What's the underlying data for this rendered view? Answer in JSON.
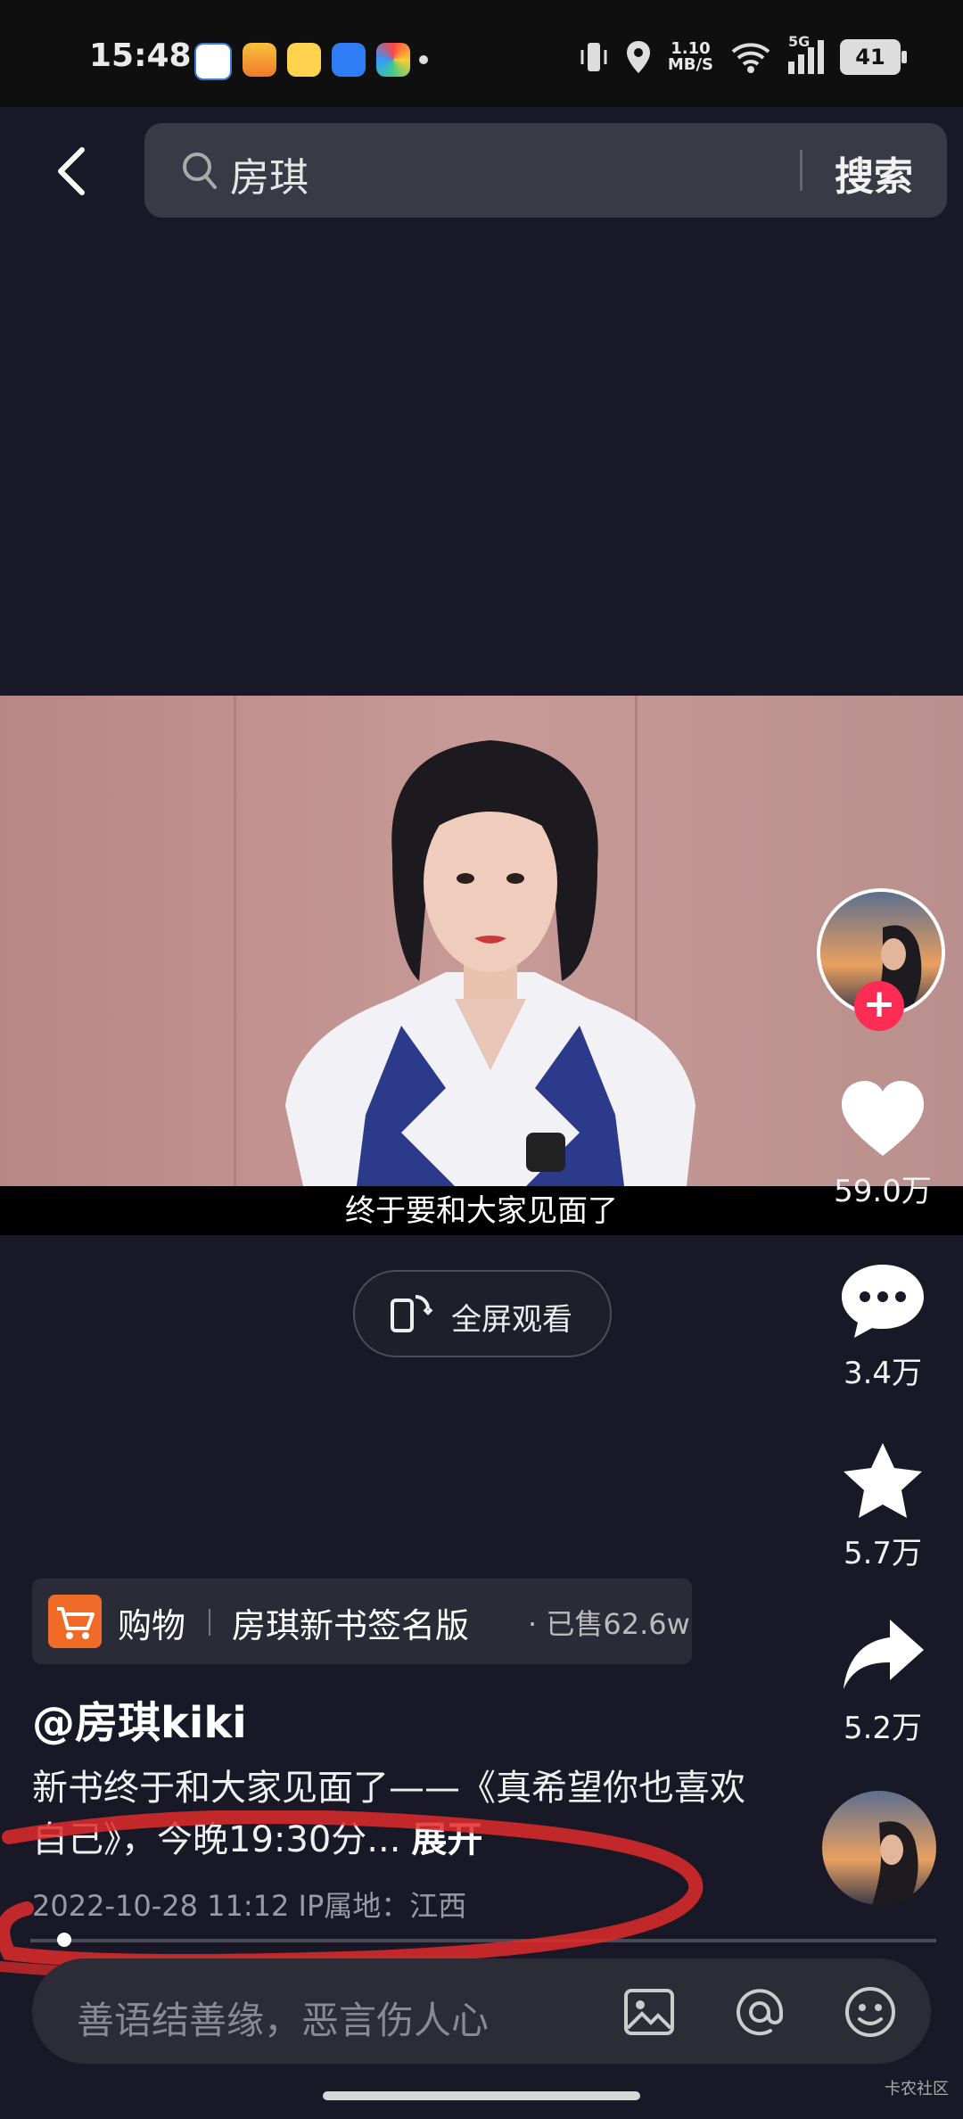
{
  "status_bar": {
    "time": "15:48",
    "net_speed_value": "1.10",
    "net_speed_unit": "MB/S",
    "network": "5G",
    "battery": "41"
  },
  "search": {
    "query": "房琪",
    "button": "搜索"
  },
  "video": {
    "subtitle": "终于要和大家见面了"
  },
  "fullscreen": {
    "label": "全屏观看"
  },
  "actions": {
    "likes": "59.0万",
    "comments": "3.4万",
    "favorites": "5.7万",
    "shares": "5.2万"
  },
  "shop": {
    "kind": "购物",
    "title": "房琪新书签名版",
    "sold": "· 已售62.6w"
  },
  "post": {
    "author": "@房琪kiki",
    "description": "新书终于和大家见面了——《真希望你也喜欢自己》，今晚19:30分...",
    "expand": "展开",
    "date": "2022-10-28 11:12",
    "ip": "IP属地：江西"
  },
  "comment_bar": {
    "placeholder": "善语结善缘，恶言伤人心"
  },
  "watermark": "卡农社区",
  "colors": {
    "background": "#181827",
    "accent": "#fe2c55",
    "shop": "#f06a28",
    "annotation": "#e02a2a"
  }
}
